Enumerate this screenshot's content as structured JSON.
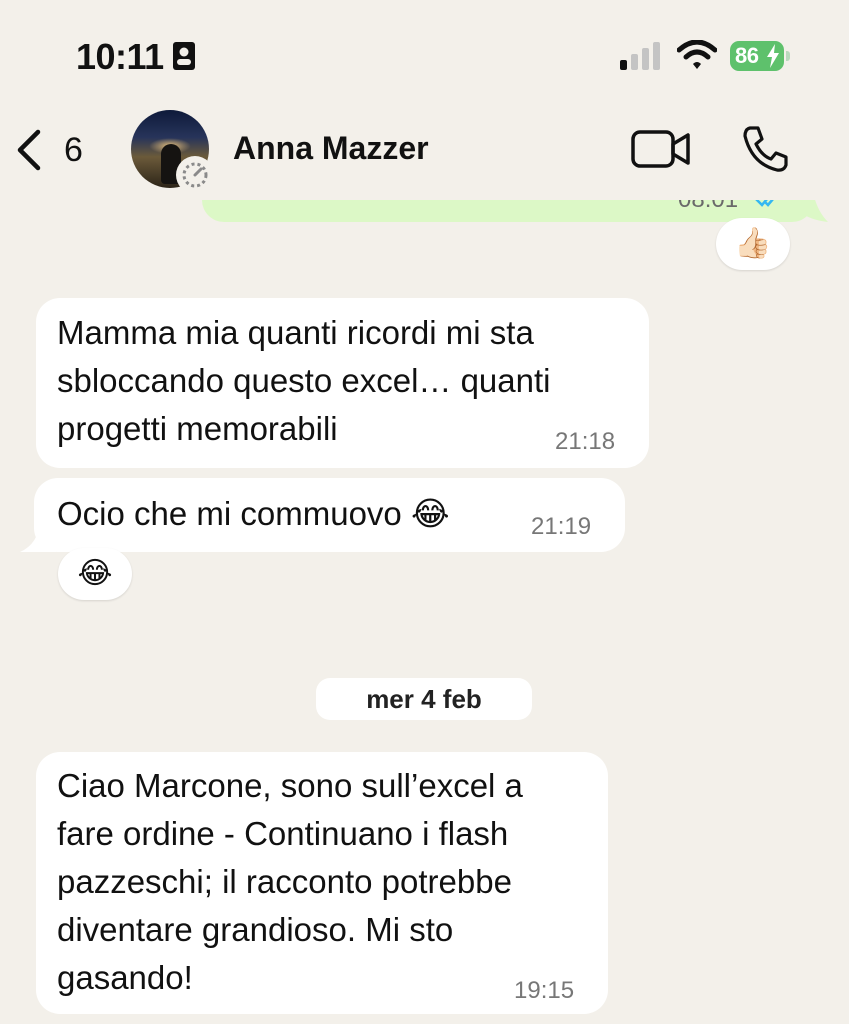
{
  "status_bar": {
    "time": "10:11",
    "battery": "86"
  },
  "header": {
    "back_count": "6",
    "contact_name": "Anna Mazzer"
  },
  "messages": {
    "outgoing_partial": {
      "time": "08:01",
      "reaction": "👍🏻"
    },
    "m1": {
      "text": "Mamma mia quanti ricordi mi sta\nsbloccando  questo excel… quanti\nprogetti memorabili",
      "time": "21:18"
    },
    "m2": {
      "text": "Ocio che mi commuovo 😂",
      "time": "21:19",
      "reaction": "😂"
    },
    "date_separator": "mer 4 feb",
    "m3": {
      "text": "Ciao Marcone, sono sull’excel a\nfare ordine - Continuano i flash\npazzeschi; il racconto potrebbe\ndiventare grandioso. Mi sto\ngasando!",
      "time": "19:15"
    }
  },
  "icons": {
    "back": "chevron-left-icon",
    "video": "video-camera-icon",
    "call": "phone-icon",
    "status": "status-ring-icon",
    "id": "id-card-icon",
    "signal": "cellular-signal-icon",
    "wifi": "wifi-icon",
    "battery": "battery-charging-icon"
  },
  "colors": {
    "background": "#f3f0ea",
    "incoming_bubble": "#ffffff",
    "outgoing_bubble": "#dcf8c6",
    "battery_green": "#5ec16c",
    "read_tick_blue": "#34b7f1"
  }
}
